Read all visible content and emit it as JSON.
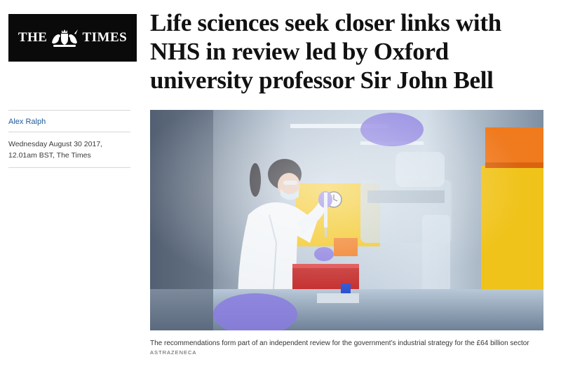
{
  "masthead": {
    "left_word": "THE",
    "right_word": "TIMES",
    "crest_icon": "royal-crest-icon"
  },
  "article": {
    "headline": "Life sciences seek closer links with NHS in review led by Oxford university professor Sir John Bell",
    "author": "Alex Ralph",
    "dateline": "Wednesday August 30 2017, 12.01am BST, The Times"
  },
  "image": {
    "caption": "The recommendations form part of an independent review for the government’s industrial strategy for the £64 billion sector",
    "credit": "ASTRAZENECA"
  },
  "colors": {
    "masthead_bg": "#0a0a0a",
    "author_link": "#1e5a9a",
    "lab_yellow": "#f2c418",
    "lab_orange": "#f07a1e",
    "tray_red": "#c42a2a",
    "glove_purple": "#8a7ce0"
  }
}
